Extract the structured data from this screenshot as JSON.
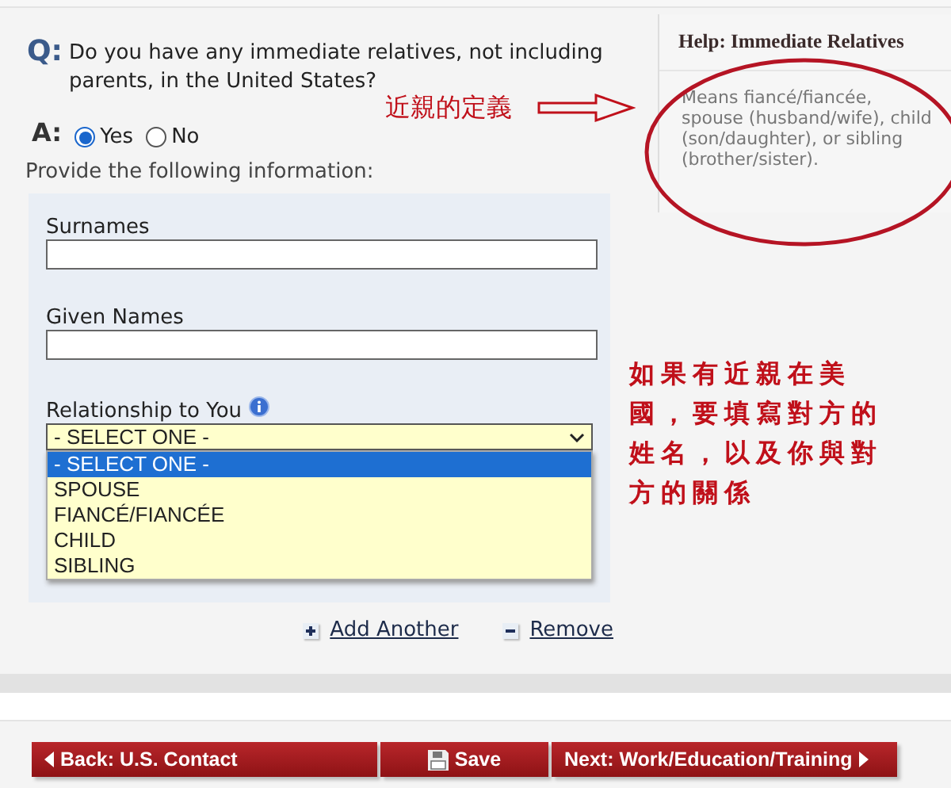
{
  "question": {
    "label": "Q:",
    "text": "Do you have any immediate relatives, not including parents, in the United States?"
  },
  "answer": {
    "label": "A:",
    "options": [
      {
        "label": "Yes",
        "selected": true
      },
      {
        "label": "No",
        "selected": false
      }
    ]
  },
  "instruction": "Provide the following information:",
  "form": {
    "fields": [
      {
        "label": "Surnames"
      },
      {
        "label": "Given Names"
      }
    ],
    "select": {
      "label": "Relationship to You",
      "value": "- SELECT ONE -",
      "expanded": true,
      "options": [
        {
          "label": "- SELECT ONE -",
          "selected": true
        },
        {
          "label": "SPOUSE",
          "selected": false
        },
        {
          "label": "FIANCÉ/FIANCÉE",
          "selected": false
        },
        {
          "label": "CHILD",
          "selected": false
        },
        {
          "label": "SIBLING",
          "selected": false
        }
      ]
    }
  },
  "links": [
    {
      "kind": "add",
      "label": "Add Another"
    },
    {
      "kind": "remove",
      "label": "Remove"
    }
  ],
  "help": {
    "title": "Help: Immediate Relatives",
    "text": "Means fiancé/fiancée, spouse (husband/wife), child (son/daughter), or sibling (brother/sister)."
  },
  "annotations": {
    "definition_note": "近親的定義",
    "instruction_note": "如果有近親在美國，要填寫對方的姓名，以及你與對方的關係"
  },
  "nav_buttons": [
    {
      "kind": "back",
      "label": "Back: U.S. Contact"
    },
    {
      "kind": "save",
      "label": "Save"
    },
    {
      "kind": "next",
      "label": "Next: Work/Education/Training"
    }
  ]
}
